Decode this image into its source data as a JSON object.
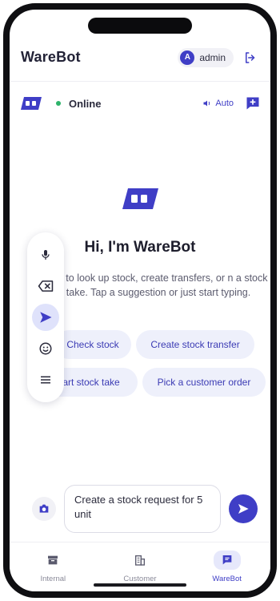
{
  "app": {
    "title": "WareBot"
  },
  "user": {
    "initial": "A",
    "name": "admin"
  },
  "status": {
    "label": "Online",
    "auto_label": "Auto"
  },
  "hero": {
    "title": "Hi, I'm WareBot",
    "subtitle": "me to look up stock, create transfers, or n a stock take. Tap a suggestion or just start typing."
  },
  "suggestions": [
    {
      "label": "Check stock"
    },
    {
      "label": "Create stock transfer"
    },
    {
      "label": "art stock take"
    },
    {
      "label": "Pick a customer order"
    }
  ],
  "side_toolbar": {
    "tools": [
      "mic-icon",
      "backspace-icon",
      "send-icon",
      "emoji-icon",
      "menu-icon"
    ],
    "active": "send-icon"
  },
  "composer": {
    "value": "Create a stock request for 5 unit"
  },
  "nav": [
    {
      "label": "Internal",
      "icon": "archive-icon",
      "active": false
    },
    {
      "label": "Customer",
      "icon": "building-icon",
      "active": false
    },
    {
      "label": "WareBot",
      "icon": "chat-icon",
      "active": true
    }
  ],
  "colors": {
    "accent": "#3f3ec6",
    "online": "#2db36a",
    "chip_bg": "#eef0fb"
  }
}
